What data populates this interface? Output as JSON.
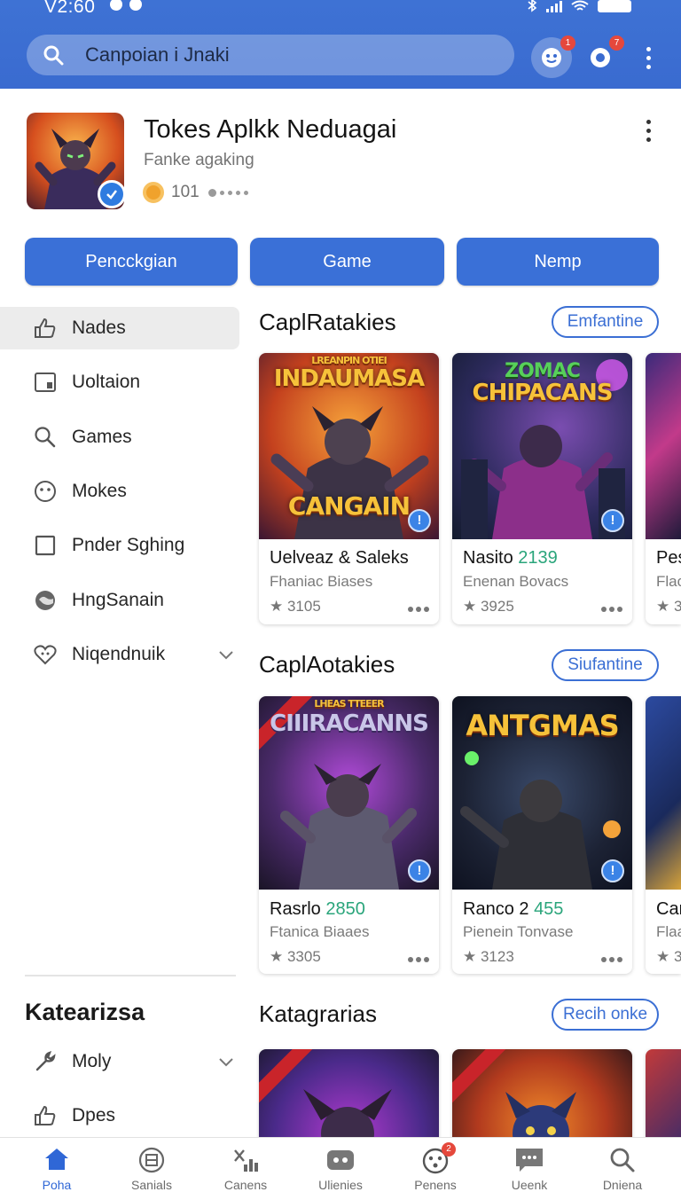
{
  "status_bar": {
    "time": "V2:60"
  },
  "search": {
    "placeholder": "Canpoian i Jnaki"
  },
  "toolbar": {
    "notif_badge": "1",
    "chat_badge": "7"
  },
  "app": {
    "title": "Tokes Aplkk Neduagai",
    "subtitle": "Fanke agaking",
    "count": "101"
  },
  "tabs": [
    {
      "label": "Pencсkgian"
    },
    {
      "label": "Game"
    },
    {
      "label": "Nemp"
    }
  ],
  "sidebar": {
    "items": [
      {
        "label": "Nades",
        "icon": "thumbs-up-icon"
      },
      {
        "label": "Uoltaion",
        "icon": "tablet-icon"
      },
      {
        "label": "Games",
        "icon": "search-icon"
      },
      {
        "label": "Mokes",
        "icon": "smiley-icon"
      },
      {
        "label": "Pnder Sghing",
        "icon": "square-icon"
      },
      {
        "label": "HngSanain",
        "icon": "globe-icon"
      },
      {
        "label": "Niqendnuik",
        "icon": "heart-icon"
      }
    ],
    "heading": "Katearizsa",
    "sub_items": [
      {
        "label": "Moly",
        "icon": "wrench-icon"
      },
      {
        "label": "Dpes",
        "icon": "thumbs-up-icon"
      }
    ]
  },
  "sections": [
    {
      "title": "CaplRatakies",
      "button": "Emfantine",
      "cards": [
        {
          "art_top": "LREANPIN OTIEI",
          "art_title": "INDAUMASA",
          "art_bottom": "CANGAIN",
          "name": "Uelveaz & Saleks",
          "name_accent": "",
          "sub": "Fhaniac Biases",
          "rating": "★ 3105"
        },
        {
          "art_top": "ZOMAC",
          "art_title": "CHIPACANS",
          "art_bottom": "",
          "name": "Nasito ",
          "name_accent": "2139",
          "sub": "Enenan Bovacs",
          "rating": "★ 3925"
        },
        {
          "art_top": "",
          "art_title": "",
          "art_bottom": "",
          "name": "Pes",
          "name_accent": "",
          "sub": "Flac",
          "rating": "★ 3"
        }
      ]
    },
    {
      "title": "CaplAotakies",
      "button": "Siufantine",
      "cards": [
        {
          "art_top": "LHEAS TTEEER",
          "art_title": "CIIIRACANNS",
          "art_bottom": "",
          "name": "Rasrlo ",
          "name_accent": "2850",
          "sub": "Ftanica Biaaes",
          "rating": "★ 3305"
        },
        {
          "art_top": "",
          "art_title": "ANTGMAS",
          "art_bottom": "",
          "name": "Ranco 2 ",
          "name_accent": "455",
          "sub": "Pienein Tonvase",
          "rating": "★ 3123"
        },
        {
          "art_top": "",
          "art_title": "",
          "art_bottom": "",
          "name": "Car",
          "name_accent": "",
          "sub": "Flaa",
          "rating": "★ 3"
        }
      ]
    },
    {
      "title": "Katagrarias",
      "button": "Recih onke",
      "cards": []
    }
  ],
  "bottom_nav": [
    {
      "label": "Poha",
      "icon": "home-icon"
    },
    {
      "label": "Sanials",
      "icon": "grid-circle-icon"
    },
    {
      "label": "Canens",
      "icon": "chart-icon"
    },
    {
      "label": "Ulienies",
      "icon": "gamepad-icon"
    },
    {
      "label": "Penens",
      "icon": "smiley-icon",
      "badge": "2"
    },
    {
      "label": "Ueenk",
      "icon": "message-icon"
    },
    {
      "label": "Dniena",
      "icon": "search-icon"
    }
  ],
  "colors": {
    "primary": "#3a70d7",
    "accent_green": "#2aa57b",
    "badge_red": "#e5483c",
    "text": "#141414"
  }
}
